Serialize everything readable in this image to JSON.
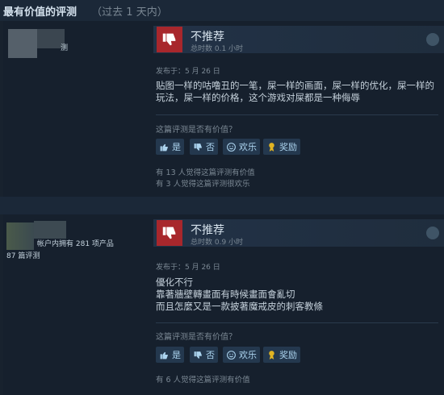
{
  "header": {
    "title": "最有价值的评测",
    "subtitle": "（过去 1 天内）"
  },
  "reviews": [
    {
      "author_suffix": "测",
      "author_info": "",
      "verdict": "不推荐",
      "hours": "总时数 0.1 小时",
      "posted": "发布于：5 月 26 日",
      "lines": [
        "贴图一样的咕噜丑的一笔，屎一样的画面，屎一样的优化，屎一样的",
        "玩法，屎一样的价格，这个游戏对屎都是一种侮辱"
      ],
      "helpful_question": "这篇评测是否有价值？",
      "buttons": {
        "yes": "是",
        "no": "否",
        "funny": "欢乐",
        "award": "奖励"
      },
      "stats": [
        "有 13 人觉得这篇评测有价值",
        "有 3 人觉得这篇评测很欢乐"
      ]
    },
    {
      "author_suffix": "",
      "author_info": "帐户内拥有 281 项产品",
      "author_reviews": "87 篇评测",
      "verdict": "不推荐",
      "hours": "总时数 0.9 小时",
      "posted": "发布于：5 月 26 日",
      "lines": [
        "優化不行",
        "靠著牆壁轉畫面有時候畫面會亂切",
        "而且怎麼又是一款披著魔戒皮的刺客教條"
      ],
      "helpful_question": "这篇评测是否有价值？",
      "buttons": {
        "yes": "是",
        "no": "否",
        "funny": "欢乐",
        "award": "奖励"
      },
      "stats": [
        "有 6 人觉得这篇评测有价值"
      ]
    }
  ],
  "colors": {
    "thumb_down": "#a8272c",
    "button": "#24384e",
    "bg": "#1b2838"
  },
  "icons": [
    "thumbs-down-icon",
    "steam-icon",
    "thumbs-up-icon",
    "smiley-icon",
    "award-icon"
  ]
}
